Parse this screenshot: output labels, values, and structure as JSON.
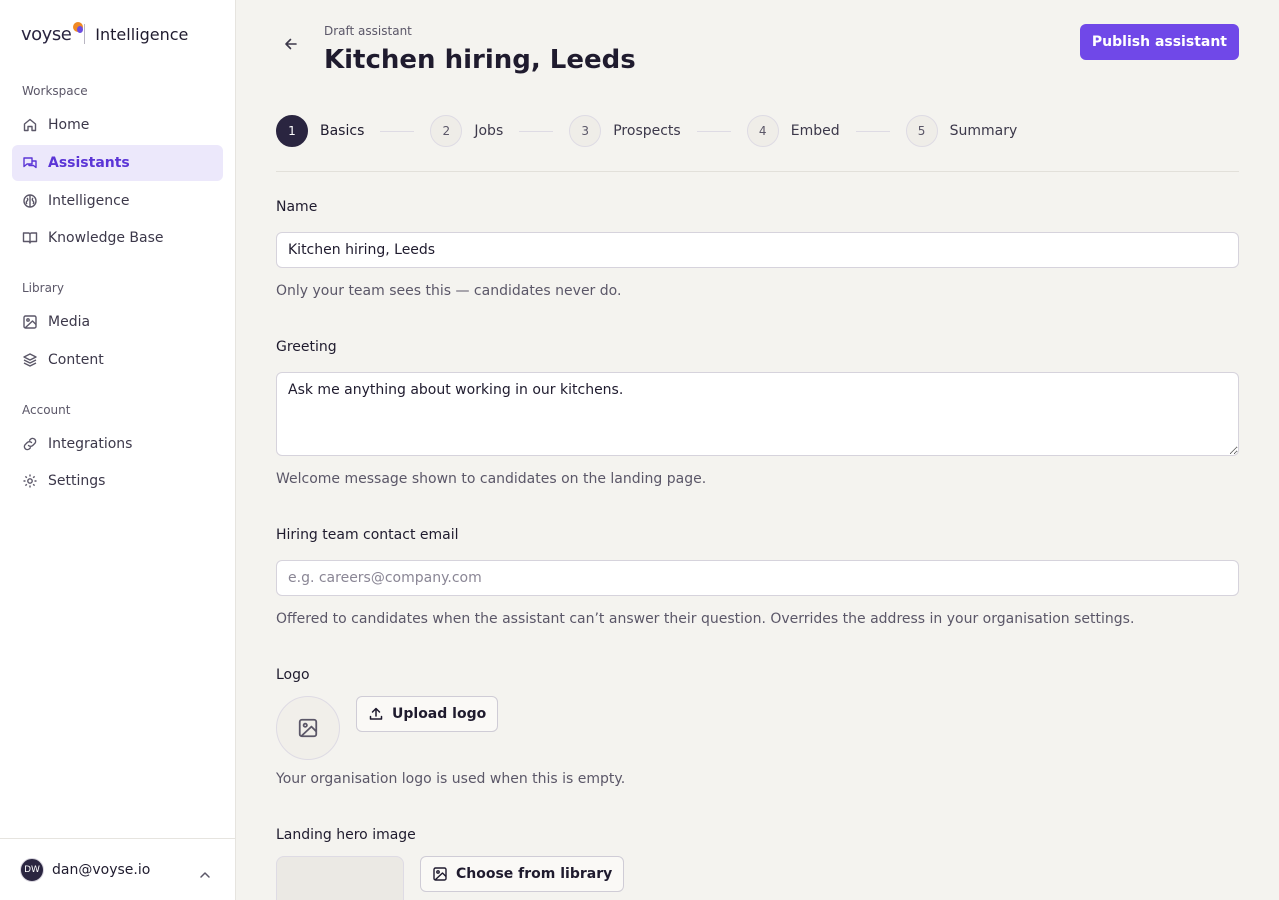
{
  "brand": {
    "logo_text": "voyse",
    "product": "Intelligence"
  },
  "sidebar": {
    "sections": [
      {
        "label": "Workspace"
      },
      {
        "label": "Library"
      },
      {
        "label": "Account"
      }
    ],
    "items": [
      {
        "label": "Home",
        "icon": "home-icon"
      },
      {
        "label": "Assistants",
        "icon": "chat-icon",
        "active": true
      },
      {
        "label": "Intelligence",
        "icon": "brain-icon"
      },
      {
        "label": "Knowledge Base",
        "icon": "book-icon"
      },
      {
        "label": "Media",
        "icon": "image-icon"
      },
      {
        "label": "Content",
        "icon": "layers-icon"
      },
      {
        "label": "Integrations",
        "icon": "link-icon"
      },
      {
        "label": "Settings",
        "icon": "gear-icon"
      }
    ],
    "user": {
      "initials": "DW",
      "email": "dan@voyse.io"
    }
  },
  "header": {
    "eyebrow": "Draft assistant",
    "title": "Kitchen hiring, Leeds",
    "publish_label": "Publish assistant"
  },
  "steps": [
    {
      "num": "1",
      "label": "Basics",
      "active": true
    },
    {
      "num": "2",
      "label": "Jobs"
    },
    {
      "num": "3",
      "label": "Prospects"
    },
    {
      "num": "4",
      "label": "Embed"
    },
    {
      "num": "5",
      "label": "Summary"
    }
  ],
  "form": {
    "name": {
      "label": "Name",
      "value": "Kitchen hiring, Leeds",
      "help": "Only your team sees this — candidates never do."
    },
    "greeting": {
      "label": "Greeting",
      "value": "Ask me anything about working in our kitchens.",
      "help": "Welcome message shown to candidates on the landing page."
    },
    "contact_email": {
      "label": "Hiring team contact email",
      "value": "",
      "placeholder": "e.g. careers@company.com",
      "help": "Offered to candidates when the assistant can’t answer their question. Overrides the address in your organisation settings."
    },
    "logo": {
      "label": "Logo",
      "upload_label": "Upload logo",
      "help": "Your organisation logo is used when this is empty."
    },
    "hero": {
      "label": "Landing hero image",
      "choose_label": "Choose from library"
    }
  },
  "colors": {
    "accent": "#7048e8",
    "active_nav_bg": "#ece8fb",
    "dark": "#2a2540"
  }
}
